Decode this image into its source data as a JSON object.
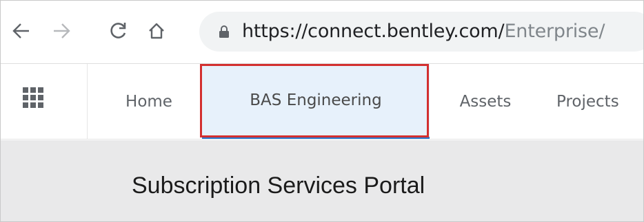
{
  "browser": {
    "back_icon": "arrow-left-icon",
    "forward_icon": "arrow-right-icon",
    "reload_icon": "reload-icon",
    "home_icon": "home-icon",
    "lock_icon": "lock-icon",
    "url_main": "https://connect.bentley.com/",
    "url_path": "Enterprise/"
  },
  "appbar": {
    "apps_icon": "apps-grid-icon",
    "tabs": [
      {
        "label": "Home",
        "active": false
      },
      {
        "label": "BAS Engineering",
        "active": true
      },
      {
        "label": "Assets",
        "active": false
      },
      {
        "label": "Projects",
        "active": false
      }
    ],
    "highlight_color": "#d32f2f",
    "active_tab_bg": "#e7f1fb",
    "active_underline": "#2a7ad0"
  },
  "main": {
    "title": "Subscription Services Portal"
  }
}
